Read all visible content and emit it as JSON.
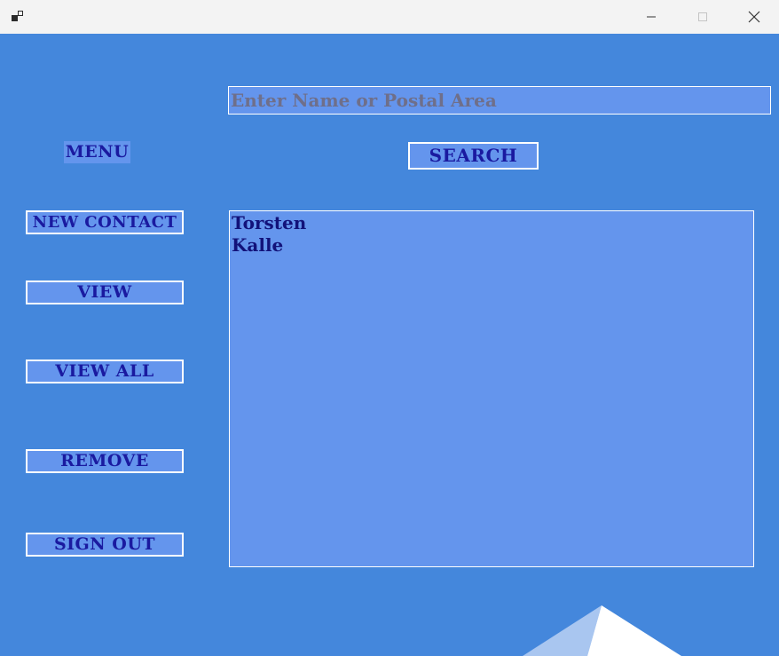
{
  "window": {
    "icon": "app-window-icon",
    "controls": {
      "minimize_icon": "minimize-icon",
      "maximize_icon": "maximize-icon",
      "close_icon": "close-icon"
    }
  },
  "search": {
    "value": "",
    "placeholder": "Enter Name or Postal Area",
    "button_label": "SEARCH"
  },
  "menu": {
    "title": "MENU",
    "items": [
      {
        "label": "NEW CONTACT"
      },
      {
        "label": "VIEW"
      },
      {
        "label": "VIEW ALL"
      },
      {
        "label": "REMOVE"
      },
      {
        "label": "SIGN OUT"
      }
    ]
  },
  "contacts": [
    "Torsten",
    "Kalle"
  ],
  "colors": {
    "background": "#4487dc",
    "panel": "#6495ed",
    "text": "#1a1aa0",
    "border": "#ffffff"
  }
}
